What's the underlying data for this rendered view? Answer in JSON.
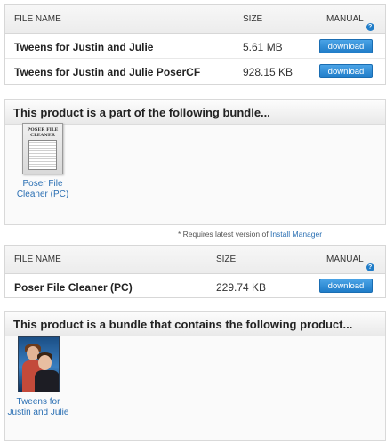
{
  "files_table_1": {
    "headers": {
      "name": "FILE NAME",
      "size": "SIZE",
      "manual": "MANUAL"
    },
    "rows": [
      {
        "name": "Tweens for Justin and Julie",
        "size": "5.61 MB",
        "button": "download"
      },
      {
        "name": "Tweens for Justin and Julie PoserCF",
        "size": "928.15 KB",
        "button": "download"
      }
    ]
  },
  "part_of_bundle": {
    "title": "This product is a part of the following bundle...",
    "product": {
      "label_line1": "Poser File",
      "label_line2": "Cleaner (PC)",
      "thumb_text": "POSER FILE CLEANER"
    }
  },
  "requirement_note": {
    "prefix": "* Requires latest version of ",
    "link": "Install Manager"
  },
  "files_table_2": {
    "headers": {
      "name": "FILE NAME",
      "size": "SIZE",
      "manual": "MANUAL"
    },
    "rows": [
      {
        "name": "Poser File Cleaner (PC)",
        "size": "229.74 KB",
        "button": "download"
      }
    ]
  },
  "bundle_contains": {
    "title": "This product is a bundle that contains the following product...",
    "product": {
      "label_line1": "Tweens for",
      "label_line2": "Justin and Julie"
    }
  },
  "colors": {
    "accent": "#1f7cc8",
    "link": "#2a6fb3"
  },
  "icons": {
    "help": "help-icon",
    "manual_help_glyph": "?"
  }
}
